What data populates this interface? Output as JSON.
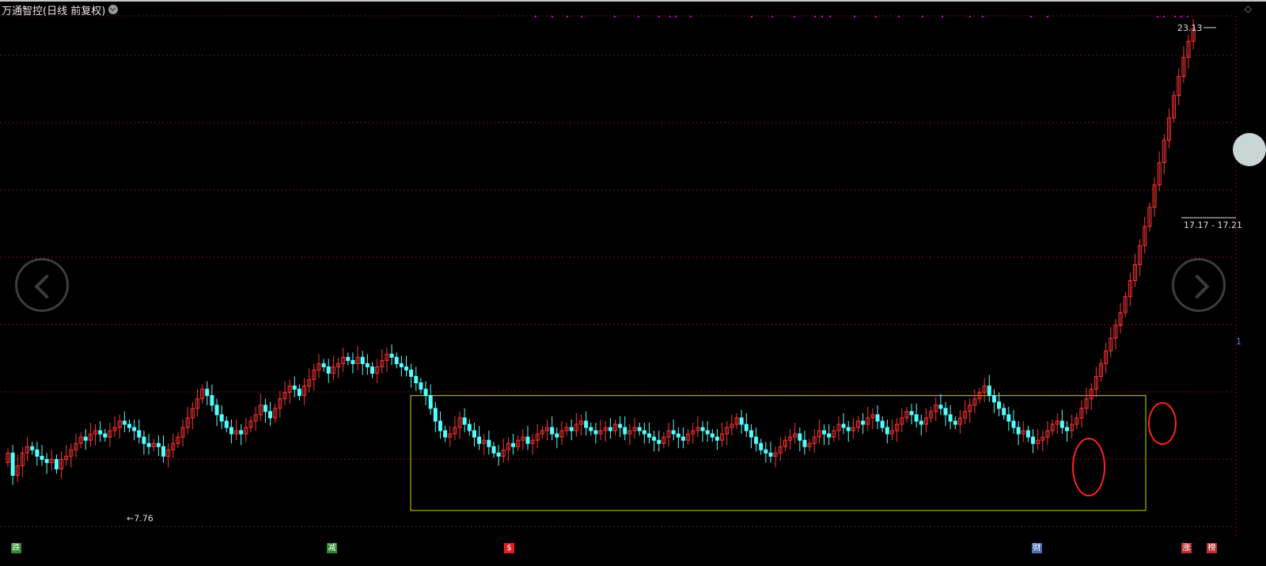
{
  "header": {
    "title": "万通智控(日线 前复权)"
  },
  "labels": {
    "high_price": "23.13",
    "low_price": "7.76",
    "range_price": "17.17 - 17.21",
    "side_num": "1"
  },
  "bottom_tags": [
    {
      "text": "跌",
      "color": "#2e8b2e"
    },
    {
      "text": "减",
      "color": "#2e8b2e"
    },
    {
      "text": "$",
      "color": "#e02020"
    },
    {
      "text": "财",
      "color": "#4a6fb5"
    },
    {
      "text": "涨",
      "color": "#c03030"
    },
    {
      "text": "榜",
      "color": "#c03030"
    }
  ],
  "colors": {
    "up": "#ff3333",
    "down": "#54ffff",
    "box": "#d4d400",
    "grid": "#7a1010",
    "annotation": "#ff2020",
    "event_dots": "#d600d6"
  },
  "chart_data": {
    "type": "candlestick",
    "title": "万通智控(日线 前复权)",
    "y_axis_visible_range": [
      7.5,
      23.5
    ],
    "marked_high": 23.13,
    "marked_low": 7.76,
    "marked_range": "17.17 - 17.21",
    "consolidation_box": {
      "low": 8.0,
      "high": 11.6,
      "note": "yellow rectangle, approx. bars 86-244"
    },
    "highlighted_bars": "two red ellipses around breakout candles near the right edge",
    "series": [
      {
        "name": "close",
        "values": [
          9.8,
          9.1,
          9.4,
          9.8,
          10.0,
          9.9,
          9.7,
          9.6,
          9.5,
          9.6,
          9.3,
          9.6,
          9.7,
          9.9,
          10.1,
          10.3,
          10.2,
          10.4,
          10.5,
          10.4,
          10.3,
          10.5,
          10.6,
          10.8,
          10.7,
          10.6,
          10.5,
          10.3,
          10.1,
          10.0,
          10.1,
          10.0,
          9.7,
          9.9,
          10.1,
          10.3,
          10.6,
          10.9,
          11.2,
          11.5,
          11.8,
          11.6,
          11.3,
          11.0,
          10.8,
          10.6,
          10.4,
          10.5,
          10.4,
          10.6,
          10.8,
          11.0,
          11.3,
          11.1,
          10.9,
          11.2,
          11.5,
          11.7,
          11.9,
          11.8,
          11.6,
          11.9,
          12.1,
          12.4,
          12.6,
          12.5,
          12.3,
          12.5,
          12.6,
          12.8,
          12.7,
          12.6,
          12.8,
          12.6,
          12.5,
          12.3,
          12.5,
          12.7,
          12.9,
          12.8,
          12.6,
          12.5,
          12.4,
          12.2,
          12.0,
          11.8,
          11.6,
          11.2,
          10.8,
          10.5,
          10.3,
          10.4,
          10.6,
          10.9,
          10.7,
          10.5,
          10.3,
          10.1,
          10.2,
          10.0,
          9.8,
          9.7,
          9.9,
          10.1,
          10.0,
          10.2,
          10.3,
          10.1,
          10.2,
          10.4,
          10.5,
          10.6,
          10.4,
          10.3,
          10.5,
          10.6,
          10.5,
          10.7,
          10.8,
          10.6,
          10.5,
          10.4,
          10.5,
          10.6,
          10.5,
          10.7,
          10.6,
          10.4,
          10.5,
          10.6,
          10.5,
          10.4,
          10.3,
          10.2,
          10.1,
          10.3,
          10.5,
          10.4,
          10.3,
          10.2,
          10.4,
          10.5,
          10.6,
          10.5,
          10.4,
          10.3,
          10.2,
          10.4,
          10.6,
          10.7,
          10.9,
          10.7,
          10.5,
          10.3,
          10.1,
          9.9,
          9.8,
          9.7,
          9.8,
          10.0,
          10.2,
          10.3,
          10.4,
          10.2,
          10.0,
          10.1,
          10.3,
          10.5,
          10.4,
          10.3,
          10.5,
          10.7,
          10.6,
          10.5,
          10.6,
          10.8,
          10.7,
          10.9,
          11.0,
          10.8,
          10.6,
          10.4,
          10.5,
          10.7,
          10.9,
          11.1,
          11.0,
          10.8,
          10.7,
          10.9,
          11.1,
          11.3,
          11.2,
          11.0,
          10.8,
          10.7,
          10.9,
          11.1,
          11.3,
          11.5,
          11.7,
          11.9,
          11.6,
          11.4,
          11.2,
          11.0,
          10.8,
          10.6,
          10.4,
          10.5,
          10.3,
          10.1,
          10.2,
          10.3,
          10.5,
          10.7,
          10.8,
          10.6,
          10.5,
          10.7,
          10.9,
          11.2,
          11.5,
          11.8,
          12.2,
          12.6,
          13.0,
          13.4,
          13.8,
          14.2,
          14.7,
          15.2,
          15.7,
          16.3,
          16.9,
          17.5,
          18.2,
          18.9,
          19.6,
          20.3,
          21.0,
          21.6,
          22.2,
          22.7,
          23.1
        ]
      }
    ]
  }
}
